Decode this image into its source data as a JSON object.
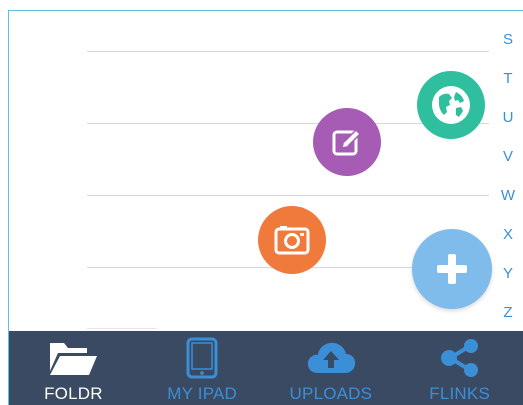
{
  "index_letters": [
    "S",
    "T",
    "U",
    "V",
    "W",
    "X",
    "Y",
    "Z"
  ],
  "fab_menu": {
    "web_link_icon": "globe-icon",
    "note_icon": "edit-icon",
    "photo_icon": "camera-icon",
    "add_icon": "plus-icon",
    "colors": {
      "web_link": "#2fbf9f",
      "note": "#a65bb5",
      "photo": "#f07a3c",
      "add": "#7fbcec"
    }
  },
  "tabs": [
    {
      "label": "FOLDR",
      "icon": "folder-open-icon",
      "active": true
    },
    {
      "label": "MY IPAD",
      "icon": "tablet-icon",
      "active": false
    },
    {
      "label": "UPLOADS",
      "icon": "cloud-upload-icon",
      "active": false
    },
    {
      "label": "FLINKS",
      "icon": "share-icon",
      "active": false
    }
  ],
  "colors": {
    "tabbar_bg": "#3a4a63",
    "tab_active": "#ffffff",
    "tab_inactive": "#3a8fd6",
    "index_letter": "#3a90d6"
  }
}
